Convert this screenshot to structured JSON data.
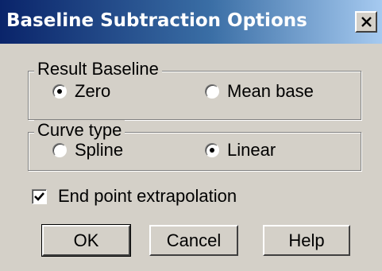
{
  "window": {
    "title": "Baseline Subtraction Options"
  },
  "result_baseline": {
    "legend": "Result Baseline",
    "options": [
      {
        "label": "Zero",
        "selected": true
      },
      {
        "label": "Mean base",
        "selected": false
      }
    ]
  },
  "curve_type": {
    "legend": "Curve type",
    "options": [
      {
        "label": "Spline",
        "selected": false
      },
      {
        "label": "Linear",
        "selected": true
      }
    ]
  },
  "extrapolation": {
    "label": "End point extrapolation",
    "checked": true
  },
  "buttons": {
    "ok": "OK",
    "cancel": "Cancel",
    "help": "Help"
  }
}
